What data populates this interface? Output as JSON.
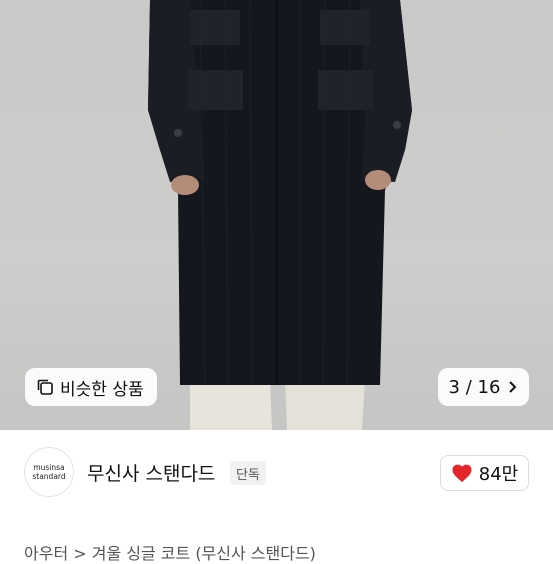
{
  "gallery": {
    "similar_label": "비슷한 상품",
    "counter_current": "3",
    "counter_total": "16",
    "counter_separator": "/"
  },
  "brand": {
    "logo_line1": "musinsa",
    "logo_line2": "standard",
    "name": "무신사 스탠다드",
    "badge": "단독"
  },
  "like": {
    "count": "84만",
    "color": "#e5252a"
  },
  "breadcrumb": {
    "text": "아우터 > 겨울 싱글 코트 (무신사 스탠다드)"
  }
}
